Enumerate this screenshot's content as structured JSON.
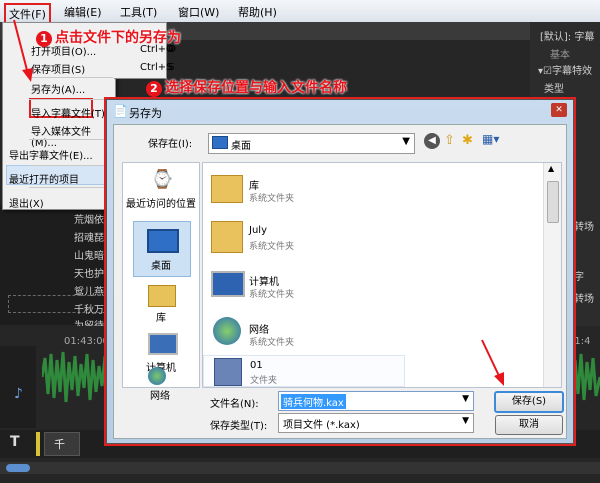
{
  "menubar": {
    "items": [
      "文件(F)",
      "编辑(E)",
      "工具(T)",
      "窗口(W)",
      "帮助(H)"
    ]
  },
  "file_menu": {
    "items": [
      {
        "label": "打开项目(O)...",
        "shortcut": "Ctrl+O"
      },
      {
        "label": "保存项目(S)",
        "shortcut": "Ctrl+S"
      },
      {
        "label": "另存为(A)...",
        "shortcut": ""
      },
      {
        "label": "导入字幕文件(T)...",
        "shortcut": ""
      },
      {
        "label": "导入媒体文件(M)...",
        "shortcut": ""
      },
      {
        "label": "导出字幕文件(E)...",
        "shortcut": ""
      },
      {
        "label": "最近打开的项目",
        "shortcut": ""
      },
      {
        "label": "退出(X)",
        "shortcut": ""
      }
    ]
  },
  "annotations": {
    "step1_num": "1",
    "step1_text": "点击文件下的另存为",
    "step2_num": "2",
    "step2_text": "选择保存位置与输入文件名称"
  },
  "right_panel": {
    "header": "[默认]: 字幕",
    "tab": "基本",
    "checkbox_label": "字幕特效",
    "row1": "类型",
    "row2": "转场",
    "row3": "字",
    "row4": "转场"
  },
  "subtitles": [
    "荒烟依旧",
    "招魂琵琶",
    "山鬼暗啼",
    "天也护佑",
    "鸳儿燕子",
    "千秋万古",
    "为留待后"
  ],
  "timeline": {
    "time1": "01:43:00",
    "time2": "01:4",
    "track_label": "千",
    "track_icon": "T"
  },
  "dialog": {
    "title": "另存为",
    "save_in_label": "保存在(I):",
    "save_in_value": "桌面",
    "places": [
      "最近访问的位置",
      "桌面",
      "库",
      "计算机",
      "网络"
    ],
    "files": [
      {
        "name": "库",
        "type": "系统文件夹",
        "icon": "library-icon"
      },
      {
        "name": "July",
        "type": "系统文件夹",
        "icon": "user-folder-icon"
      },
      {
        "name": "计算机",
        "type": "系统文件夹",
        "icon": "computer-icon"
      },
      {
        "name": "网络",
        "type": "系统文件夹",
        "icon": "network-icon"
      },
      {
        "name": "01",
        "type": "文件夹",
        "icon": "folder-icon"
      }
    ],
    "filename_label": "文件名(N):",
    "filename_value": "骑兵何物.kax",
    "filetype_label": "保存类型(T):",
    "filetype_value": "项目文件 (*.kax)",
    "save_button": "保存(S)",
    "cancel_button": "取消"
  },
  "colors": {
    "annotation_red": "#e8141c",
    "dialog_frame": "#b7cde6",
    "wave_green": "#2f8a3c"
  }
}
